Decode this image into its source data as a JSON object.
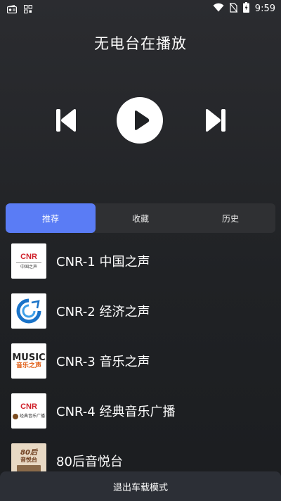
{
  "status_bar": {
    "time": "9:59",
    "icons": [
      "radio-icon",
      "app-grid-icon",
      "wifi-icon",
      "no-sim-icon",
      "battery-charging-icon"
    ]
  },
  "player": {
    "title": "无电台在播放",
    "controls": [
      "previous-icon",
      "play-icon",
      "next-icon"
    ]
  },
  "tabs": [
    {
      "label": "推荐",
      "active": true
    },
    {
      "label": "收藏",
      "active": false
    },
    {
      "label": "历史",
      "active": false
    }
  ],
  "stations": [
    {
      "name": "CNR-1 中国之声",
      "logo": "cnr-voice-of-china-logo"
    },
    {
      "name": "CNR-2 经济之声",
      "logo": "cnr-economy-logo"
    },
    {
      "name": "CNR-3 音乐之声",
      "logo": "music-radio-logo"
    },
    {
      "name": "CNR-4 经典音乐广播",
      "logo": "cnr-classic-music-logo"
    },
    {
      "name": "80后音悦台",
      "logo": "80s-music-logo"
    }
  ],
  "logo_text": {
    "cnr": "CNR",
    "cnr1_sub": "中国之声",
    "cnr3_top": "MUSIC",
    "cnr3_sub": "音乐之声",
    "cnr4_sub": "经典音乐广播",
    "s5_top": "80后",
    "s5_sub": "音悦台"
  },
  "bottom_bar": {
    "label": "退出车载模式"
  },
  "colors": {
    "accent": "#5a7cf5",
    "background": "#202225",
    "tab_bg": "#2f3033",
    "bottom_bar": "#2c2f36"
  }
}
